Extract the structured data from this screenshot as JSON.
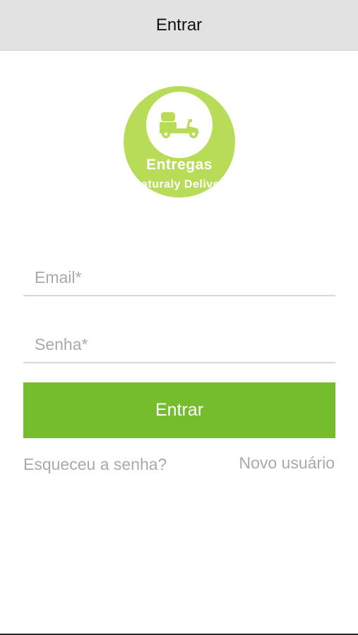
{
  "nav": {
    "title": "Entrar"
  },
  "logo": {
    "title": "Entregas",
    "subtitle": "aturaly Delive",
    "icon": "scooter-icon",
    "outer_color": "#b8dc58"
  },
  "form": {
    "email_placeholder": "Email*",
    "password_placeholder": "Senha*",
    "submit_label": "Entrar",
    "button_color": "#76bd2e"
  },
  "links": {
    "forgot_password": "Esqueceu a senha?",
    "new_user": "Novo usuário"
  }
}
